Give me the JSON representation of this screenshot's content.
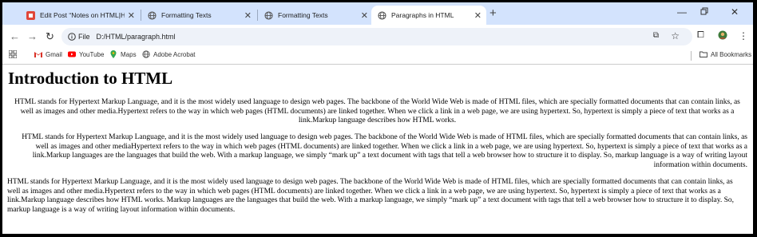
{
  "tabs": [
    {
      "title": "Edit Post “Notes on HTML|HTML",
      "favicon": "edit-post-icon",
      "active": false
    },
    {
      "title": "Formatting Texts",
      "favicon": "globe-icon",
      "active": false
    },
    {
      "title": "Formatting Texts",
      "favicon": "globe-icon",
      "active": false
    },
    {
      "title": "Paragraphs in HTML",
      "favicon": "globe-icon",
      "active": true
    }
  ],
  "toolbar": {
    "info_label": "File",
    "url": "D:/HTML/paragraph.html"
  },
  "bookmarks": {
    "items": [
      {
        "label": "Gmail",
        "icon": "gmail-icon"
      },
      {
        "label": "YouTube",
        "icon": "youtube-icon"
      },
      {
        "label": "Maps",
        "icon": "maps-icon"
      },
      {
        "label": "Adobe Acrobat",
        "icon": "globe-icon"
      }
    ],
    "all_label": "All Bookmarks"
  },
  "page": {
    "heading": "Introduction to HTML",
    "paragraphs": [
      "HTML stands for Hypertext Markup Language, and it is the most widely used language to design web pages. The backbone of the World Wide Web is made of HTML files, which are specially formatted documents that can contain links, as well as images and other media.Hypertext refers to the way in which web pages (HTML documents) are linked together. When we click a link in a web page, we are using hypertext. So, hypertext is simply a piece of text that works as a link.Markup language describes how HTML works.",
      "HTML stands for Hypertext Markup Language, and it is the most widely used language to design web pages. The backbone of the World Wide Web is made of HTML files, which are specially formatted documents that can contain links, as well as images and other mediaHypertext refers to the way in which web pages (HTML documents) are linked together. When we click a link in a web page, we are using hypertext. So, hypertext is simply a piece of text that works as a link.Markup languages are the languages that build the web. With a markup language, we simply “mark up” a text document with tags that tell a web browser how to structure it to display. So, markup language is a way of writing layout information within documents.",
      "HTML stands for Hypertext Markup Language, and it is the most widely used language to design web pages. The backbone of the World Wide Web is made of HTML files, which are specially formatted documents that can contain links, as well as images and other media.Hypertext refers to the way in which web pages (HTML documents) are linked together. When we click a link in a web page, we are using hypertext. So, hypertext is simply a piece of text that works as a link.Markup language describes how HTML works. Markup languages are the languages that build the web. With a markup language, we simply “mark up” a text document with tags that tell a web browser how to structure it to display. So, markup language is a way of writing layout information within documents."
    ]
  },
  "colors": {
    "tabstrip": "#d3e3fd",
    "omnibox": "#eef2f9"
  }
}
